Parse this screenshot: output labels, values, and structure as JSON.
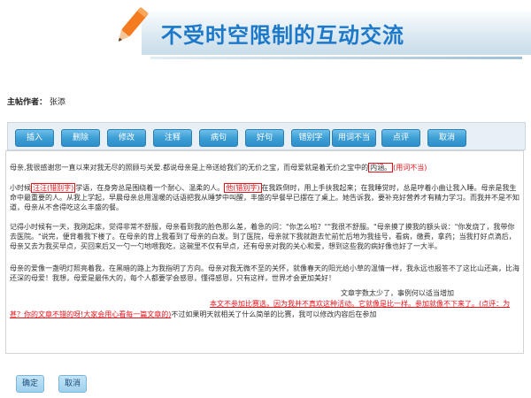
{
  "header": {
    "title": "不受时空限制的互动交流",
    "icon": "pencil-icon"
  },
  "author": {
    "label": "主帖作者：",
    "name": "张添"
  },
  "toolbar": [
    {
      "label": "插入",
      "name": "insert-button"
    },
    {
      "label": "删除",
      "name": "delete-button"
    },
    {
      "label": "修改",
      "name": "modify-button"
    },
    {
      "label": "注释",
      "name": "annotate-button"
    },
    {
      "label": "病句",
      "name": "faulty-sentence-button"
    },
    {
      "label": "好句",
      "name": "good-sentence-button"
    },
    {
      "label": "错别字",
      "name": "typo-button"
    },
    {
      "label": "用词不当",
      "name": "improper-word-button"
    },
    {
      "label": "点评",
      "name": "comment-button"
    },
    {
      "label": "取消",
      "name": "cancel-button"
    }
  ],
  "editor": {
    "p1": {
      "text": "母亲,我很感谢您一直以来对我无尽的照顾与关爱.都说母亲是上帝送给我们的无价之宝，而母爱就是着无价之宝中的",
      "boxed": "内涵。",
      "note": "(用词不当)"
    },
    "p2": {
      "a": "小时候",
      "b": "汪汪(错别字)",
      "c": "学语，在身旁总是围绕着一个耐心、温柔的人。",
      "d": "他(错别字)",
      "e": "在我跌倒时，用上手扶我起来；在我睡觉时，总是哼着小曲让我入睡。母亲是我生命中最重要的人。从我上学起，早晨母亲总用温暖的话语把我从睡梦中叫醒，丰盛的早餐早已摆在了桌上。她告诉我，要补充好营养才有精力学习。而我并不是不知道，母亲从不舍得吃这么丰盛的餐。"
    },
    "p3": "记得小时候有一天，我刚起床，觉得非常不舒服，母亲看到我的脸色那么差，着急的问：\"你怎么啦？\"\"我很不舒服。\"母亲摸了摸我的额头说：\"你发烧了，我带你去医院。\"说完，便背着我下楼了。在母亲的背上我看到了母亲的白发。到了医院，母亲就下我就跑去忙前忙后地为我挂号，看病，缴费，拿药；当我打好点滴后，母亲又去为我买早点，买回来后又一勺一勺地喂我吃，这碗里不仅有早点，还有母亲对我的关心和爱，想到这些我的病好像也好了一大半。",
    "p4": "母亲的爱像一盏明灯照亮着我，在黑暗的路上为我指明了方向。母亲对我无微不至的关怀，就像春天的阳光给小草的温情一样，我永远也报答不了这比山还高，比海还深的母爱！我想，母爱是最伟大的，每个人都要学会感恩，懂得感恩，只有这样，世界才会更加美好！",
    "note1": "文章字数太少了，事例何以适当增加",
    "note2": "本文不参加比赛选，因为我并不真欢这种活动。它就像是比一样。参加就像不下来了。(点评：为",
    "note3_a": "甚？你的文章不错的呀!大家会用心看每一篇文章的)",
    "note3_b": "不过如果明天就相关了什么简单的比赛，我可以修改内容后在参加"
  },
  "footer": {
    "confirm": "确定",
    "cancel": "取消"
  },
  "colors": {
    "accent": "#1c78c8",
    "button": "#3d9fd6",
    "annotation": "#e0151b"
  }
}
